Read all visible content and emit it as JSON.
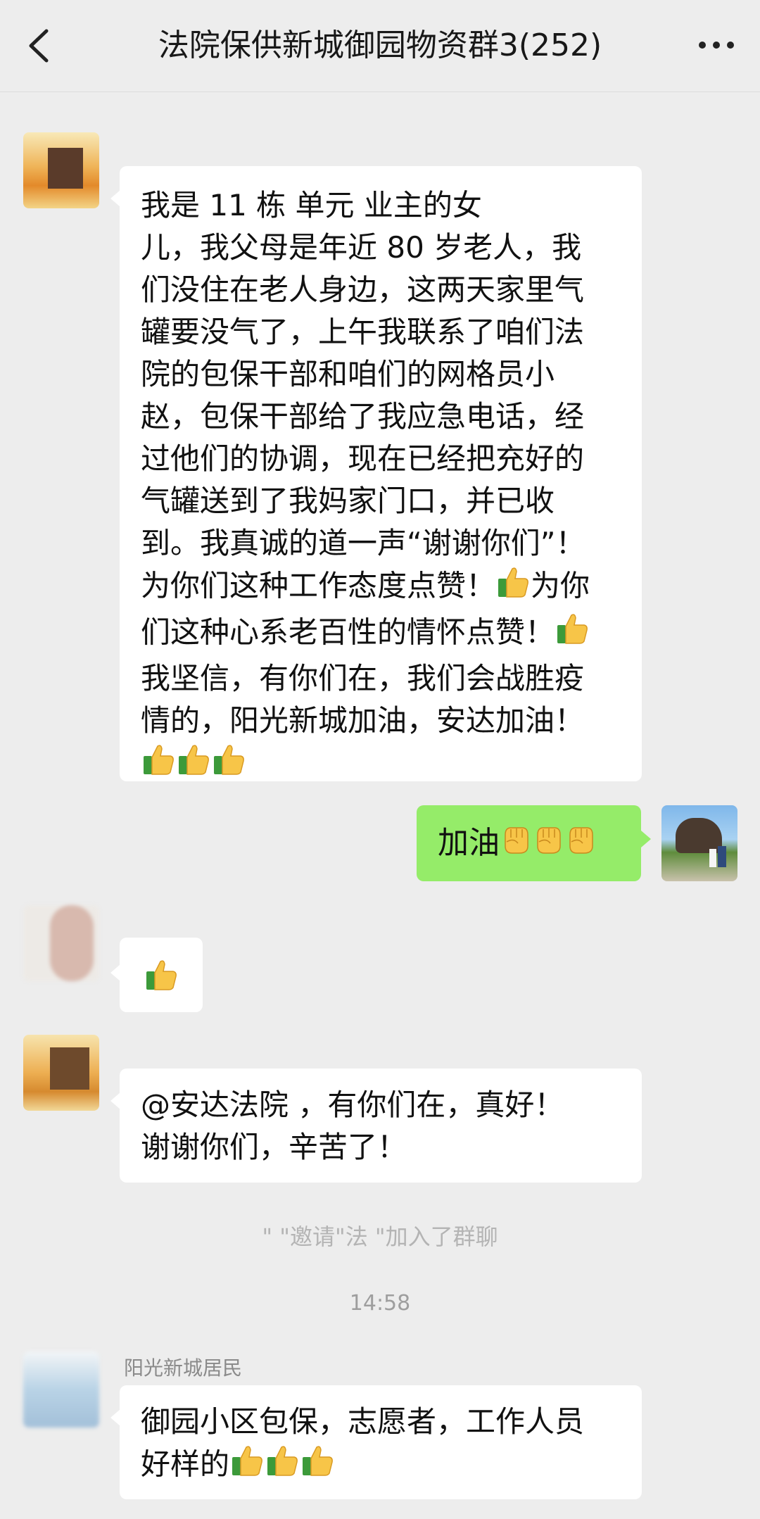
{
  "header": {
    "title": "法院保供新城御园物资群3(252)"
  },
  "messages": [
    {
      "side": "left",
      "lines": [
        "我是 11 栋      单元          业主的女",
        "儿，我父母是年近 80 岁老人，我",
        "们没住在老人身边，这两天家里气",
        "罐要没气了，上午我联系了咱们法",
        "院的包保干部和咱们的网格员小",
        "赵，包保干部给了我应急电话，经",
        "过他们的协调，现在已经把充好的",
        "气罐送到了我妈家门口，并已收",
        "到。我真诚的道一声“谢谢你们”！",
        "为你们这种工作态度点赞！",
        "为你",
        "们这种心系老百性的情怀点赞！",
        "我坚信，有你们在，我们会战胜疫",
        "情的，阳光新城加油，安达加油！"
      ]
    },
    {
      "side": "right",
      "text": "加油"
    },
    {
      "side": "left",
      "emoji": "thumbs-up"
    },
    {
      "side": "left",
      "lines": [
        "@安达法院 ，有你们在，真好！",
        "谢谢你们，辛苦了！"
      ]
    },
    {
      "side": "left",
      "sender": "阳光新城居民",
      "lines": [
        "御园小区包保，志愿者，工作人员",
        "好样的"
      ]
    }
  ],
  "system": {
    "join_notice": "\"     \"邀请\"法     \"加入了群聊",
    "time": "14:58"
  },
  "colors": {
    "background": "#EDEDED",
    "bubble_left": "#FFFFFF",
    "bubble_right": "#95EC69",
    "thumb": "#F7C548",
    "cuff": "#3C9A3A"
  },
  "icons": [
    "back-arrow-icon",
    "more-icon",
    "thumbs-up-icon",
    "fist-icon"
  ]
}
